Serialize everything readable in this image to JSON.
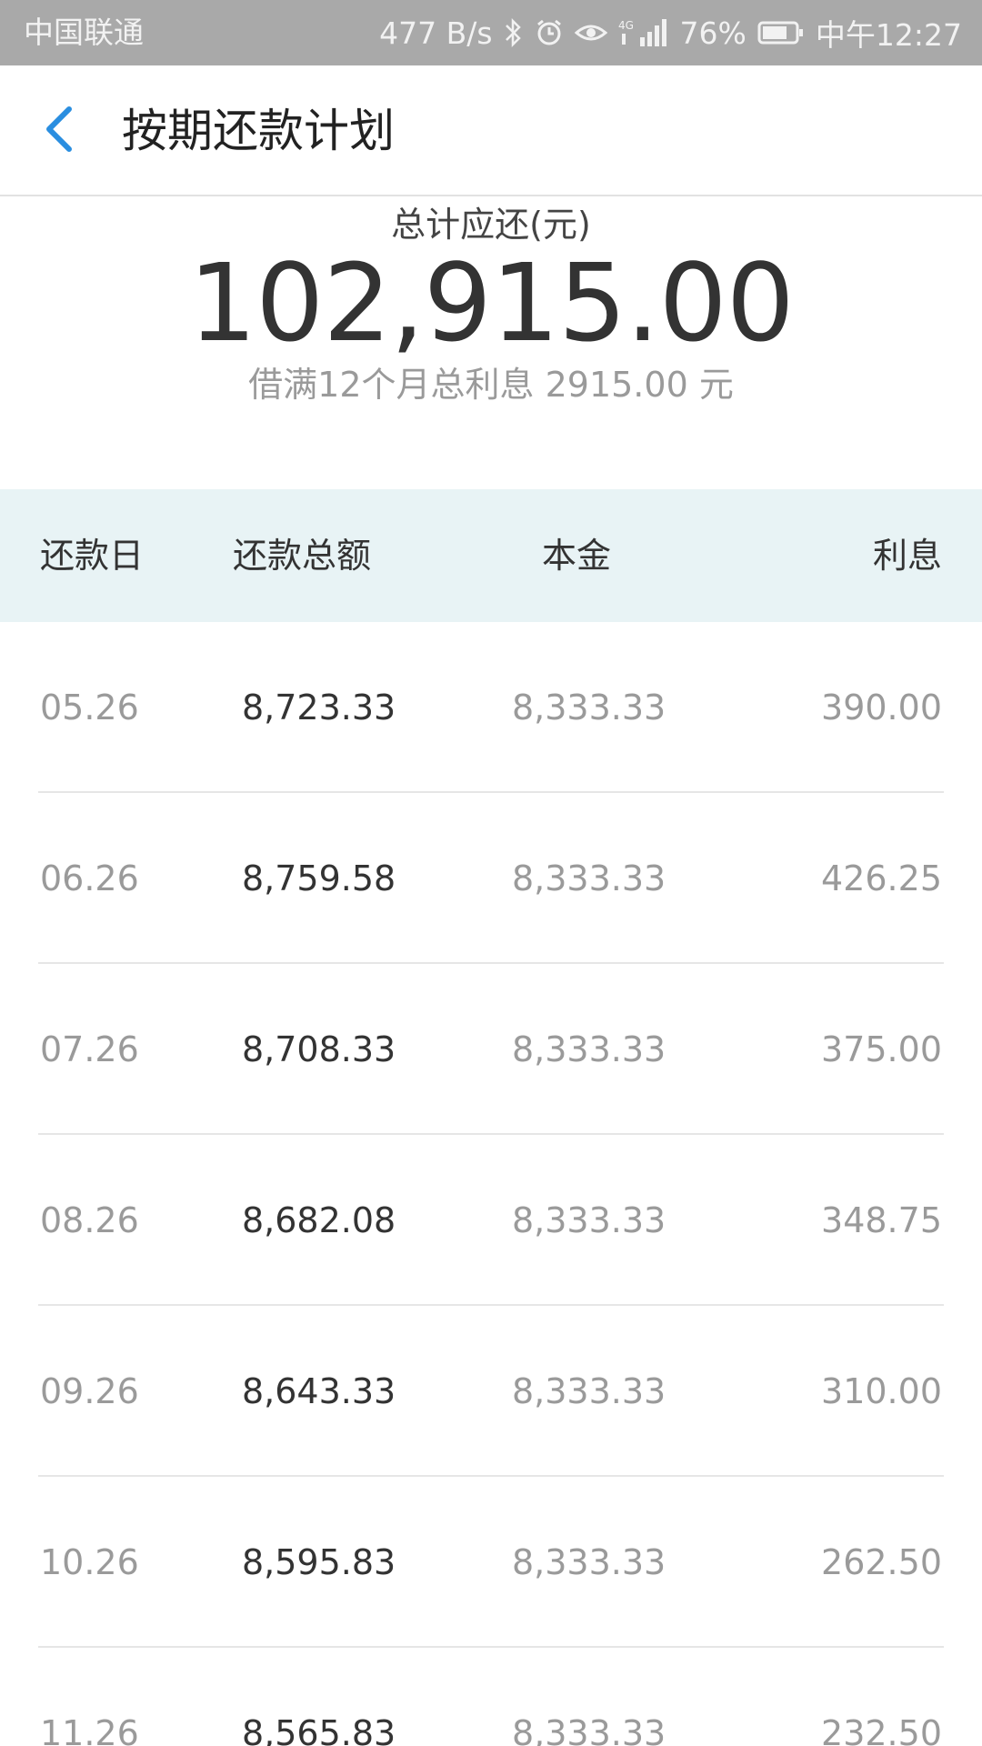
{
  "status_bar": {
    "carrier": "中国联通",
    "speed": "477 B/s",
    "battery": "76%",
    "time": "中午12:27",
    "icons": [
      "bluetooth-icon",
      "alarm-icon",
      "eye-icon",
      "signal-4g-icon",
      "battery-icon"
    ]
  },
  "header": {
    "title": "按期还款计划",
    "back_icon": "chevron-left-icon",
    "accent_color": "#2a8ee0"
  },
  "summary": {
    "label": "总计应还(元)",
    "amount": "102,915.00",
    "note": "借满12个月总利息 2915.00 元"
  },
  "table": {
    "columns": [
      "还款日",
      "还款总额",
      "本金",
      "利息"
    ],
    "rows": [
      {
        "date": "05.26",
        "total": "8,723.33",
        "principal": "8,333.33",
        "interest": "390.00"
      },
      {
        "date": "06.26",
        "total": "8,759.58",
        "principal": "8,333.33",
        "interest": "426.25"
      },
      {
        "date": "07.26",
        "total": "8,708.33",
        "principal": "8,333.33",
        "interest": "375.00"
      },
      {
        "date": "08.26",
        "total": "8,682.08",
        "principal": "8,333.33",
        "interest": "348.75"
      },
      {
        "date": "09.26",
        "total": "8,643.33",
        "principal": "8,333.33",
        "interest": "310.00"
      },
      {
        "date": "10.26",
        "total": "8,595.83",
        "principal": "8,333.33",
        "interest": "262.50"
      },
      {
        "date": "11.26",
        "total": "8,565.83",
        "principal": "8,333.33",
        "interest": "232.50"
      }
    ]
  }
}
